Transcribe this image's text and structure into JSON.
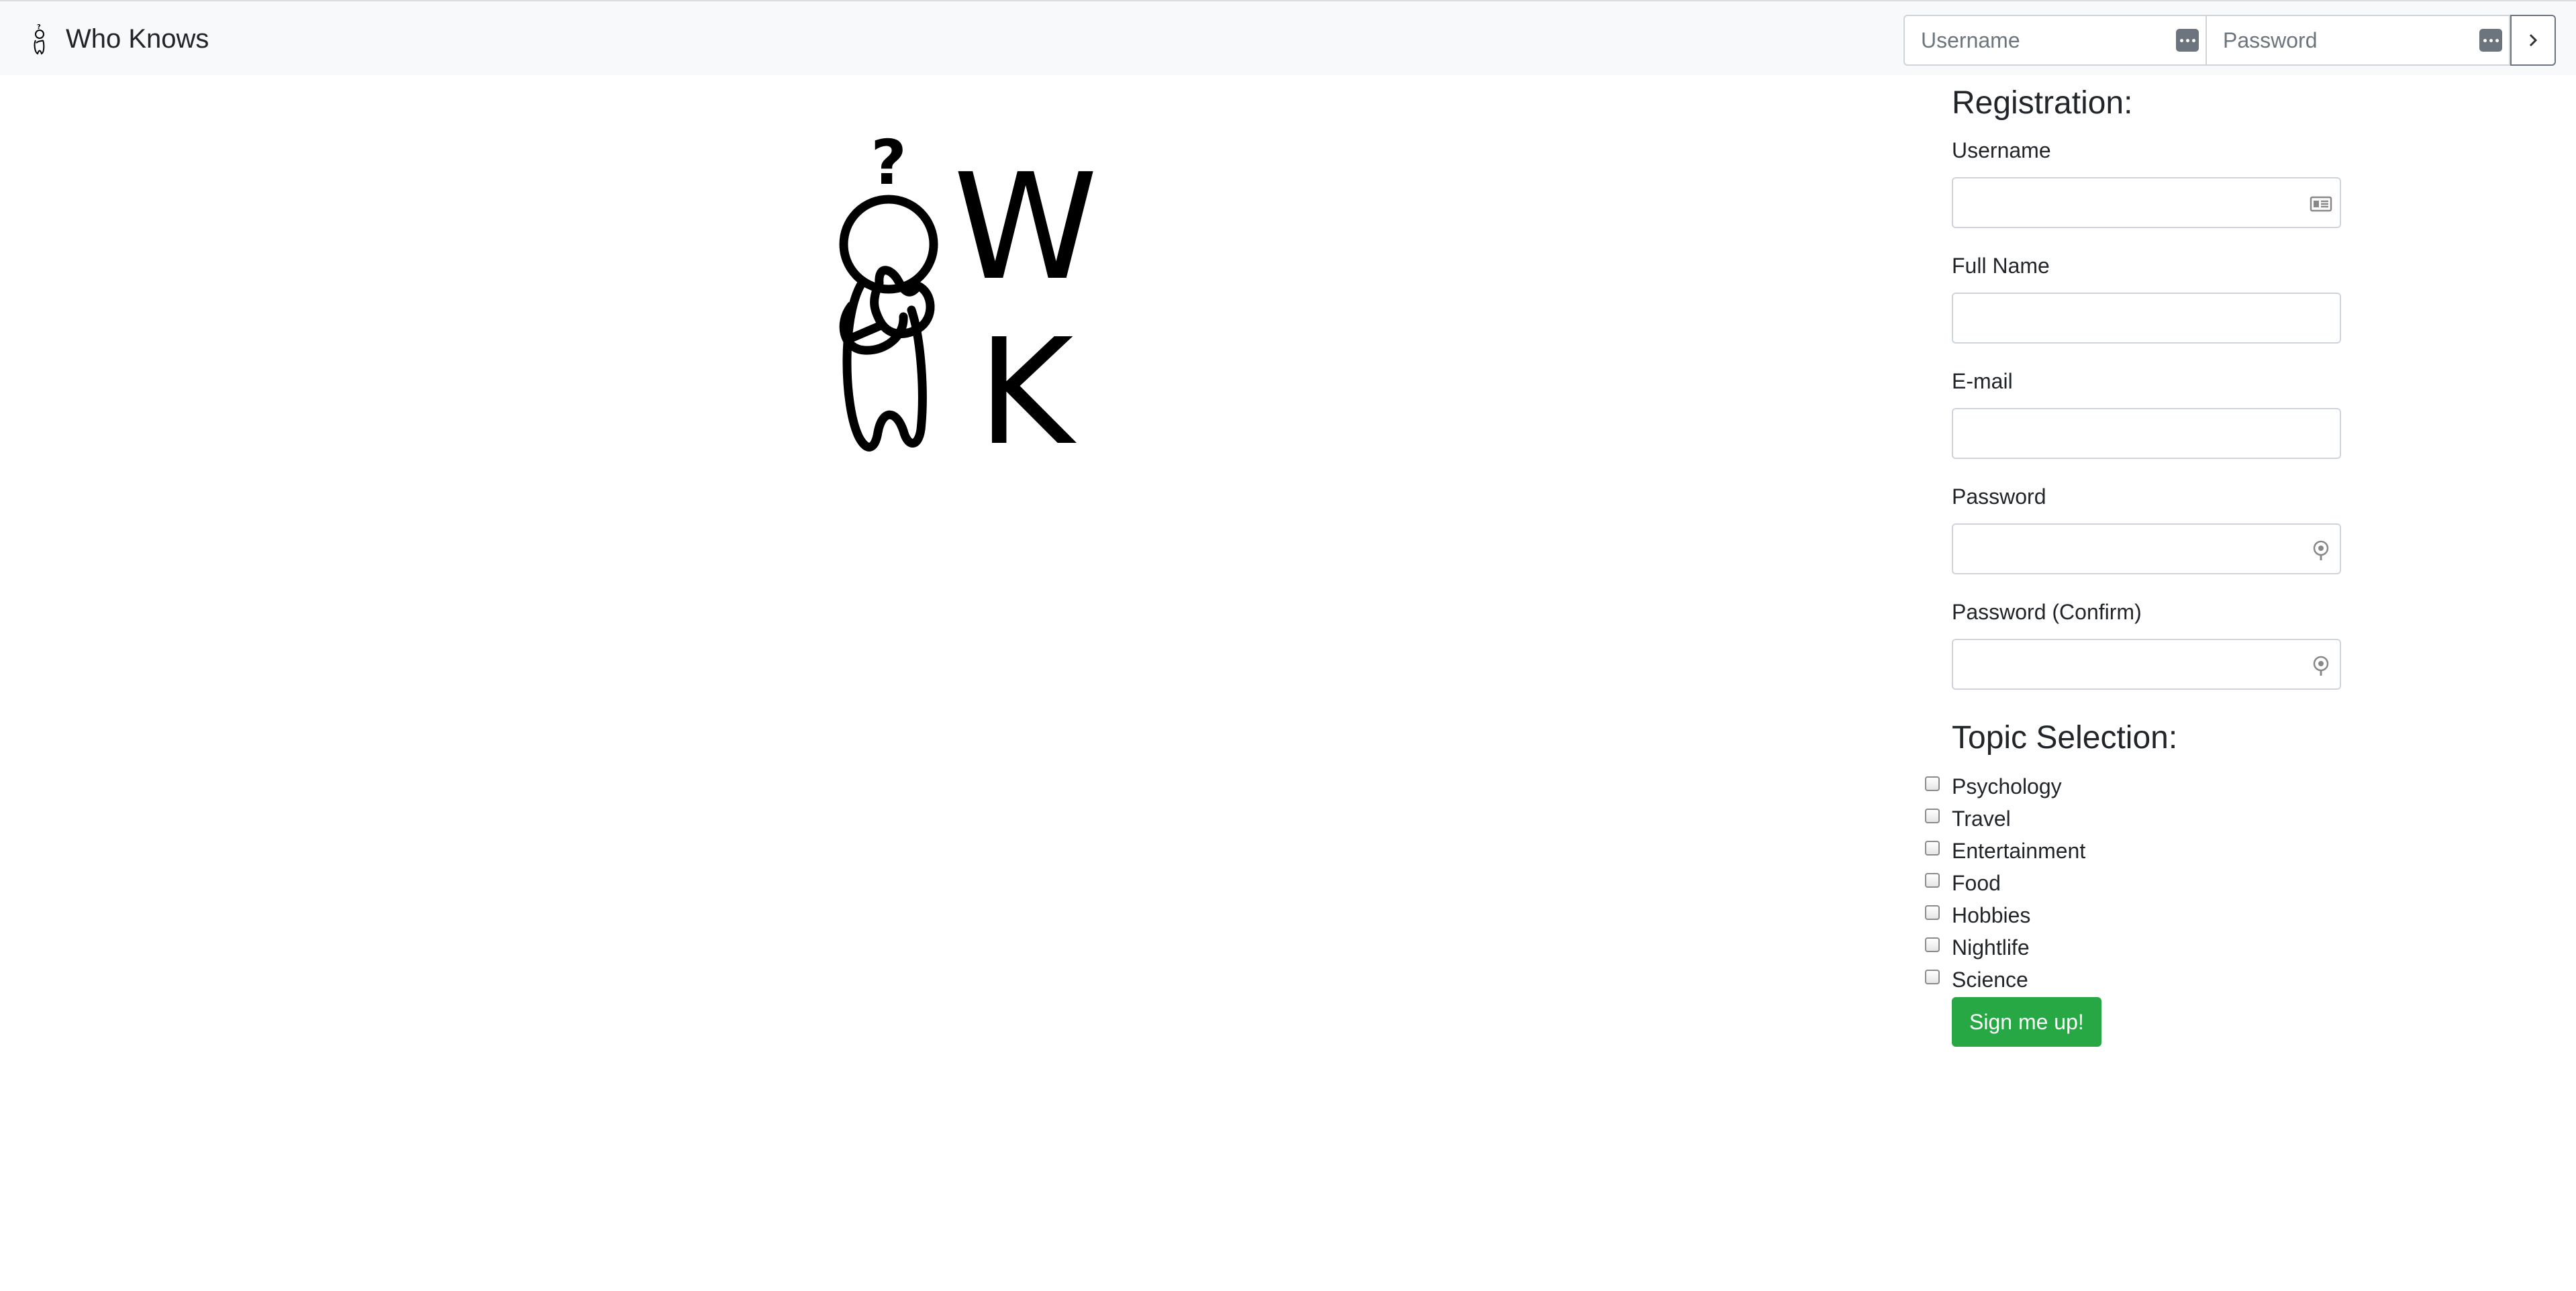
{
  "navbar": {
    "brand": "Who Knows",
    "login": {
      "username_placeholder": "Username",
      "password_placeholder": "Password"
    }
  },
  "logo": {
    "letter_top": "W",
    "letter_bottom": "K"
  },
  "registration": {
    "title": "Registration:",
    "fields": [
      {
        "label": "Username",
        "value": ""
      },
      {
        "label": "Full Name",
        "value": ""
      },
      {
        "label": "E-mail",
        "value": ""
      },
      {
        "label": "Password",
        "value": ""
      },
      {
        "label": "Password (Confirm)",
        "value": ""
      }
    ],
    "topics_title": "Topic Selection:",
    "topics": [
      "Psychology",
      "Travel",
      "Entertainment",
      "Food",
      "Hobbies",
      "Nightlife",
      "Science"
    ],
    "submit_label": "Sign me up!"
  },
  "colors": {
    "navbar_bg": "#f8f9fa",
    "submit_bg": "#28a745",
    "badge_bg": "#6c757d"
  }
}
